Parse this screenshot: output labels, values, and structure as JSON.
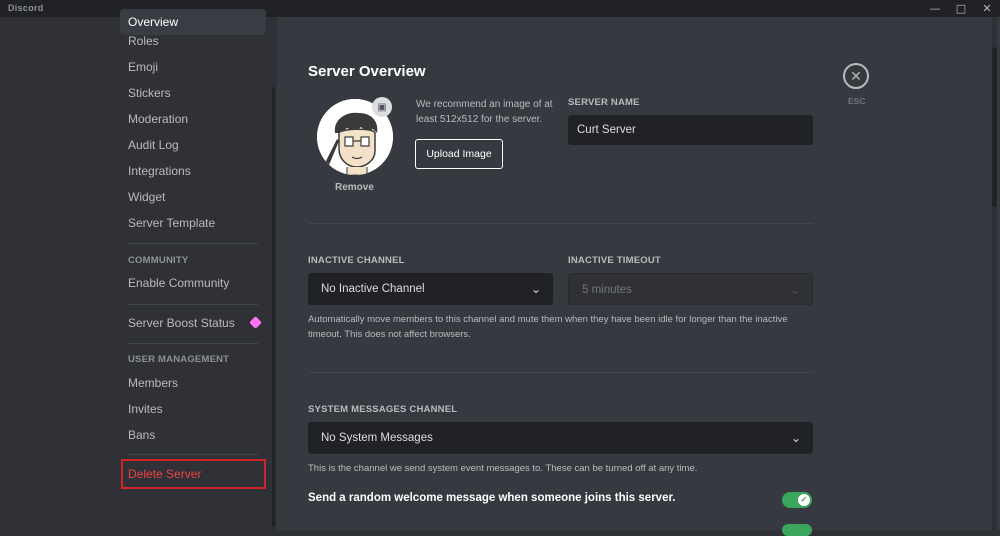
{
  "window": {
    "title": "Discord"
  },
  "sidebar": {
    "items": [
      {
        "label": "Overview"
      },
      {
        "label": "Roles"
      },
      {
        "label": "Emoji"
      },
      {
        "label": "Stickers"
      },
      {
        "label": "Moderation"
      },
      {
        "label": "Audit Log"
      },
      {
        "label": "Integrations"
      },
      {
        "label": "Widget"
      },
      {
        "label": "Server Template"
      }
    ],
    "community_header": "COMMUNITY",
    "enable_community": "Enable Community",
    "server_boost_status": "Server Boost Status",
    "user_management_header": "USER MANAGEMENT",
    "members": "Members",
    "invites": "Invites",
    "bans": "Bans",
    "delete_server": "Delete Server"
  },
  "main": {
    "title": "Server Overview",
    "avatar": {
      "remove_label": "Remove"
    },
    "recommend_text": "We recommend an image of at least 512x512 for the server.",
    "upload_button": "Upload Image",
    "server_name_label": "SERVER NAME",
    "server_name_value": "Curt Server",
    "inactive_channel_label": "INACTIVE CHANNEL",
    "inactive_channel_value": "No Inactive Channel",
    "inactive_timeout_label": "INACTIVE TIMEOUT",
    "inactive_timeout_value": "5 minutes",
    "inactive_help": "Automatically move members to this channel and mute them when they have been idle for longer than the inactive timeout. This does not affect browsers.",
    "system_messages_label": "SYSTEM MESSAGES CHANNEL",
    "system_messages_value": "No System Messages",
    "system_help": "This is the channel we send system event messages to. These can be turned off at any time.",
    "welcome_toggle_label": "Send a random welcome message when someone joins this server.",
    "welcome_toggle_on": true,
    "esc_label": "ESC"
  },
  "colors": {
    "accent_green": "#3ba55c",
    "danger_red": "#ed4245",
    "boost_pink": "#ff73fa"
  }
}
